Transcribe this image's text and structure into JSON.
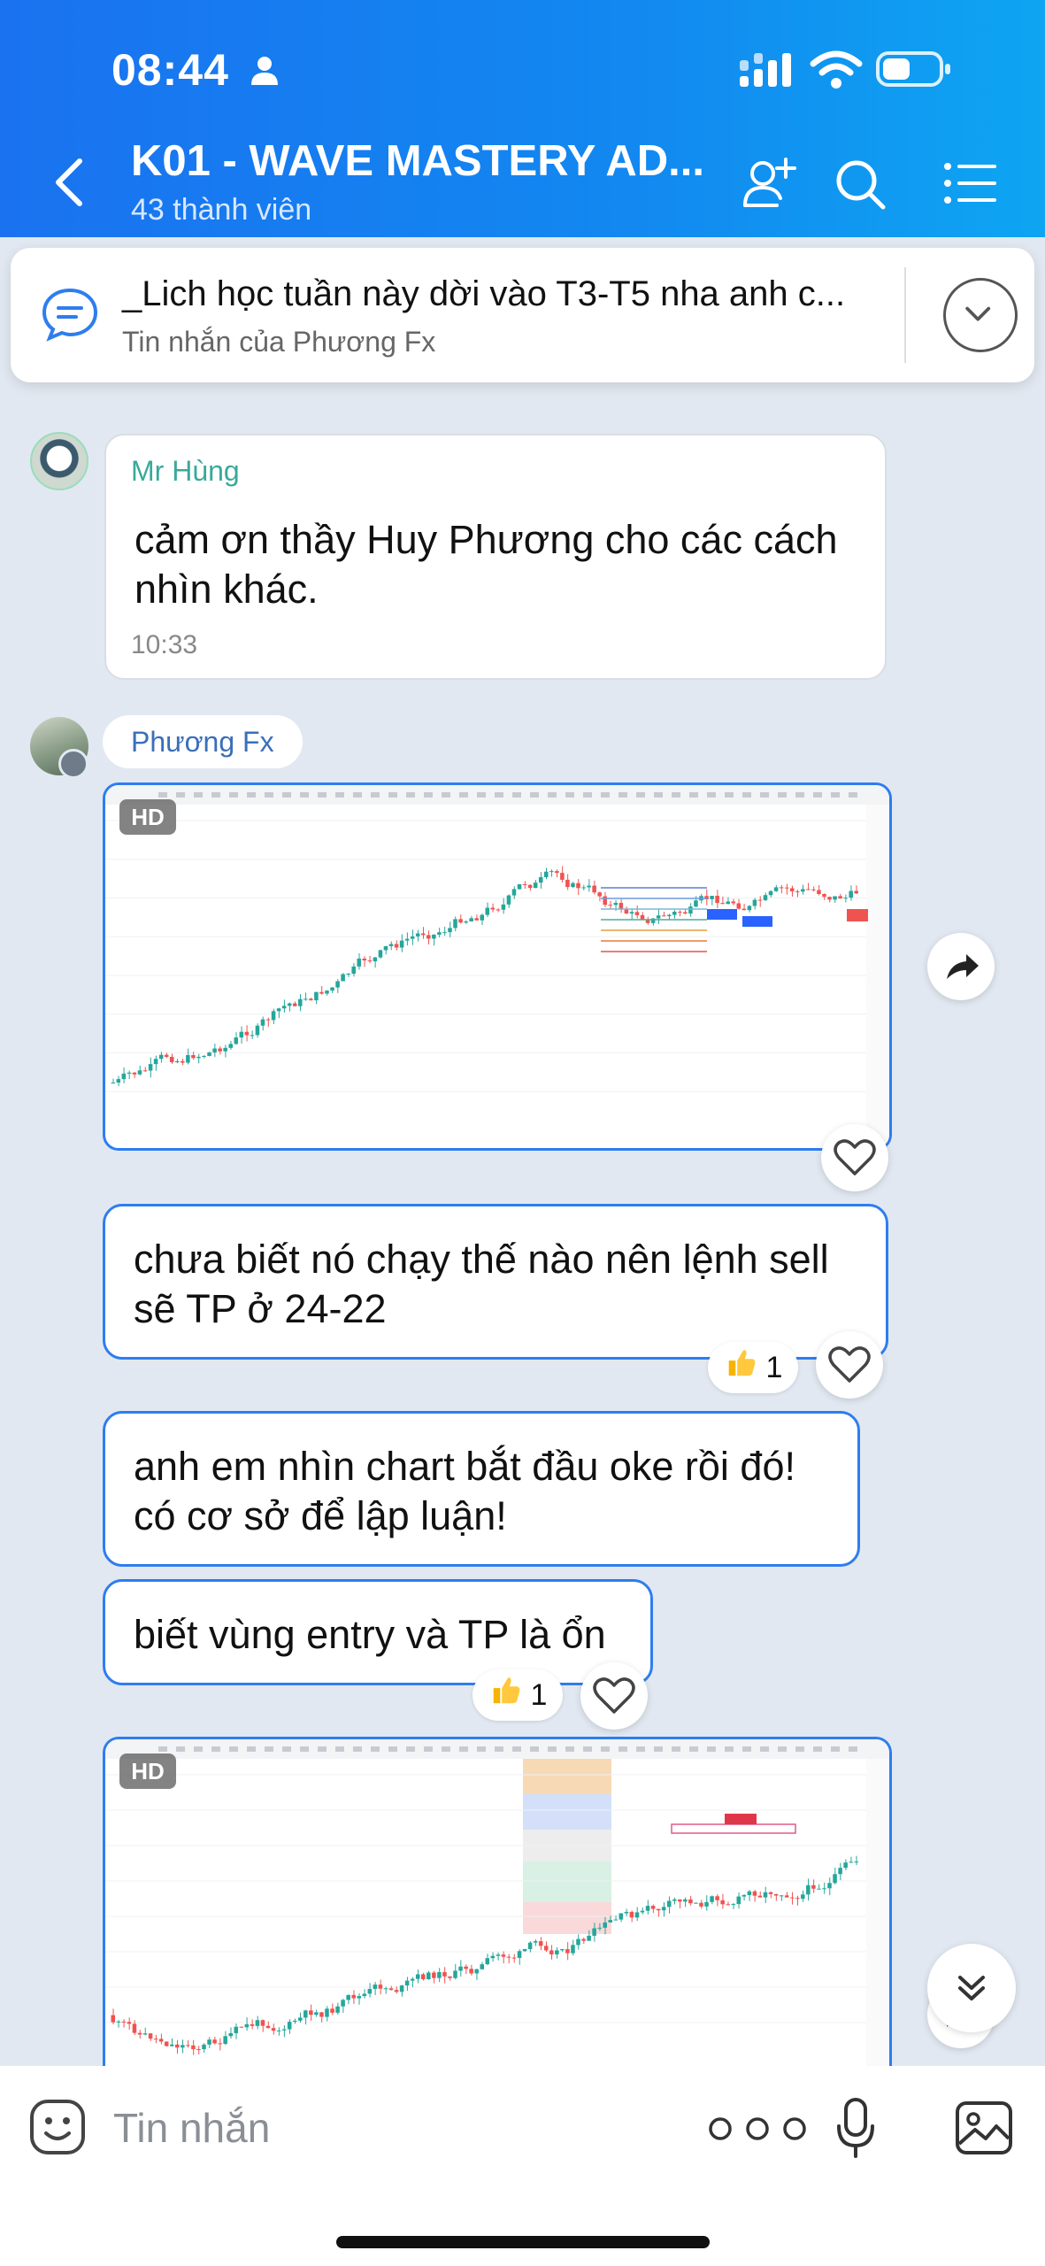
{
  "status_bar": {
    "time": "08:44"
  },
  "header": {
    "title": "K01 - WAVE MASTERY AD...",
    "subtitle": "43 thành viên"
  },
  "pinned": {
    "text": "_Lich học tuần này dời vào T3-T5 nha anh c...",
    "sub": "Tin nhắn của Phương Fx"
  },
  "messages": [
    {
      "sender": "Mr Hùng",
      "text": "cảm ơn thầy Huy Phương cho các cách nhìn khác.",
      "time": "10:33"
    },
    {
      "sender": "Phương Fx",
      "image_badge": "HD"
    },
    {
      "text": "chưa biết nó chạy thế nào nên lệnh sell sẽ TP ở 24-22",
      "reaction_count": "1"
    },
    {
      "text": "anh em nhìn chart bắt đầu oke rồi đó! có cơ sở để lập luận!"
    },
    {
      "text": "biết vùng entry và TP là ổn",
      "reaction_count": "1"
    },
    {
      "image_badge": "HD"
    }
  ],
  "composer": {
    "placeholder": "Tin nhắn"
  },
  "colors": {
    "header": "#1a7ff0",
    "accent": "#2e7df0",
    "sender_green": "#3aa99a",
    "sender_blue": "#3a6fb8"
  },
  "icons": [
    "person-icon",
    "signal-icon",
    "wifi-icon",
    "battery-icon",
    "back-icon",
    "add-member-icon",
    "search-icon",
    "menu-icon",
    "pin-icon",
    "chevron-down-icon",
    "share-icon",
    "heart-icon",
    "thumbs-up-icon",
    "double-chevron-down-icon",
    "emoji-icon",
    "more-icon",
    "mic-icon",
    "gallery-icon"
  ]
}
